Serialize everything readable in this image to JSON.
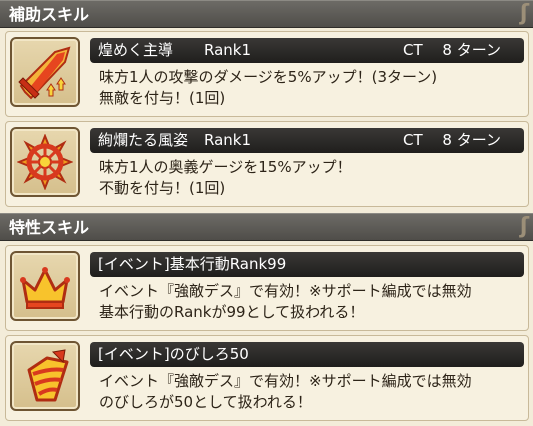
{
  "sections": {
    "support": {
      "title": "補助スキル"
    },
    "trait": {
      "title": "特性スキル"
    }
  },
  "cards": [
    {
      "name": "煌めく主導",
      "rank": "Rank1",
      "ct": "CT　 8 ターン",
      "lines": [
        "味方1人の攻撃のダメージを5%アップ！(3ターン)",
        "無敵を付与！(1回)"
      ],
      "icon": "sword-icon"
    },
    {
      "name": "絢爛たる風姿",
      "rank": "Rank1",
      "ct": "CT　 8 ターン",
      "lines": [
        "味方1人の奥義ゲージを15%アップ！",
        "不動を付与！(1回)"
      ],
      "icon": "wheel-icon"
    },
    {
      "name": "[イベント]基本行動Rank99",
      "lines": [
        "イベント『強敵デス』で有効！※サポート編成では無効",
        "基本行動のRankが99として扱われる！"
      ],
      "icon": "crown-icon"
    },
    {
      "name": "[イベント]のびしろ50",
      "lines": [
        "イベント『強敵デス』で有効！※サポート編成では無効",
        "のびしろが50として扱われる！"
      ],
      "icon": "drill-icon"
    }
  ],
  "colors": {
    "header": "#5e5c58",
    "title_bar": "#2b2927",
    "card": "#f7f1e0",
    "icon_red": "#d8391e",
    "icon_orange": "#f19a1d",
    "icon_yellow": "#f8d43a"
  }
}
